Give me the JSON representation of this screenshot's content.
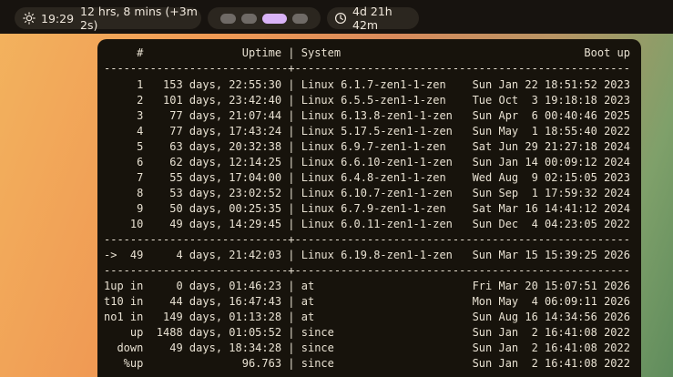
{
  "topbar": {
    "clock": {
      "icon": "sun-icon",
      "time": "19:29",
      "daylight": "12 hrs, 8 mins (+3m 2s)"
    },
    "workspaces": [
      {
        "active": false
      },
      {
        "active": false
      },
      {
        "active": true
      },
      {
        "active": false
      }
    ],
    "uptime": {
      "icon": "clock-icon",
      "value": "4d 21h 42m"
    }
  },
  "terminal": {
    "lines": [
      "     #               Uptime | System                                     Boot up",
      "----------------------------+---------------------------------------------------",
      "     1   153 days, 22:55:30 | Linux 6.1.7-zen1-1-zen    Sun Jan 22 18:51:52 2023",
      "     2   101 days, 23:42:40 | Linux 6.5.5-zen1-1-zen    Tue Oct  3 19:18:18 2023",
      "     3    77 days, 21:07:44 | Linux 6.13.8-zen1-1-zen   Sun Apr  6 00:40:46 2025",
      "     4    77 days, 17:43:24 | Linux 5.17.5-zen1-1-zen   Sun May  1 18:55:40 2022",
      "     5    63 days, 20:32:38 | Linux 6.9.7-zen1-1-zen    Sat Jun 29 21:27:18 2024",
      "     6    62 days, 12:14:25 | Linux 6.6.10-zen1-1-zen   Sun Jan 14 00:09:12 2024",
      "     7    55 days, 17:04:00 | Linux 6.4.8-zen1-1-zen    Wed Aug  9 02:15:05 2023",
      "     8    53 days, 23:02:52 | Linux 6.10.7-zen1-1-zen   Sun Sep  1 17:59:32 2024",
      "     9    50 days, 00:25:35 | Linux 6.7.9-zen1-1-zen    Sat Mar 16 14:41:12 2024",
      "    10    49 days, 14:29:45 | Linux 6.0.11-zen1-1-zen   Sun Dec  4 04:23:05 2022",
      "----------------------------+---------------------------------------------------",
      "->  49     4 days, 21:42:03 | Linux 6.19.8-zen1-1-zen   Sun Mar 15 15:39:25 2026",
      "----------------------------+---------------------------------------------------",
      "1up in     0 days, 01:46:23 | at                        Fri Mar 20 15:07:51 2026",
      "t10 in    44 days, 16:47:43 | at                        Mon May  4 06:09:11 2026",
      "no1 in   149 days, 01:13:28 | at                        Sun Aug 16 14:34:56 2026",
      "    up  1488 days, 01:05:52 | since                     Sun Jan  2 16:41:08 2022",
      "  down    49 days, 18:34:28 | since                     Sun Jan  2 16:41:08 2022",
      "   %up               96.763 | since                     Sun Jan  2 16:41:08 2022"
    ]
  }
}
